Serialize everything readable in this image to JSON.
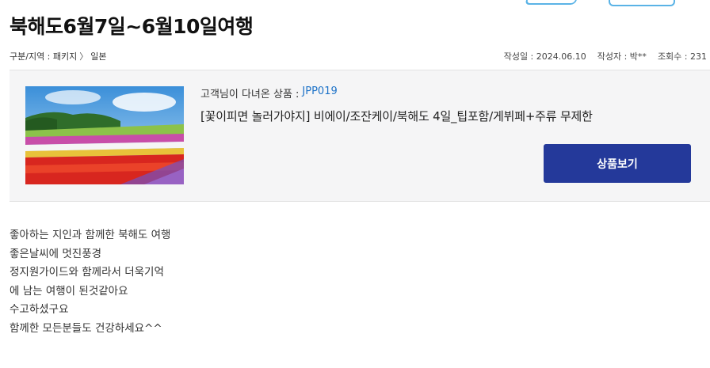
{
  "header": {
    "title": "북해도6월7일~6월10일여행"
  },
  "meta": {
    "category": "구분/지역 : 패키지",
    "region": "일본",
    "date_label": "작성일 : 2024.06.10",
    "author_label": "작성자 : 박**",
    "views_label": "조회수 : 231"
  },
  "product": {
    "code_label": "고객님이 다녀온 상품 :",
    "code": "JPP019",
    "name": "[꽃이피면 놀러가야지] 비에이/조잔케이/북해도 4일_팁포함/게뷔페+주류 무제한",
    "button_label": "상품보기"
  },
  "review": {
    "lines": [
      "좋아하는 지인과 함께한 북해도 여행",
      "좋은날씨에 멋진풍경",
      "정지원가이드와 함께라서 더욱기억",
      "에 남는 여행이 된것같아요",
      "수고하셨구요",
      "함께한 모든분들도 건강하세요^^"
    ]
  },
  "colors": {
    "accent_button": "#24399a",
    "product_code": "#1e73c8",
    "box_background": "#f5f5f6"
  }
}
